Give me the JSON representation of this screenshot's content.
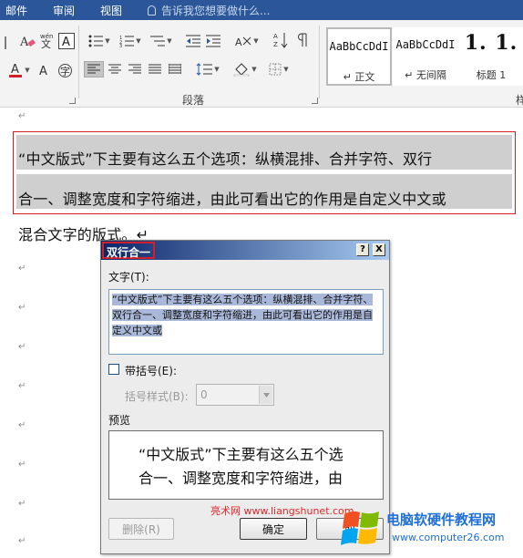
{
  "ribbon_tabs": [
    "邮件",
    "审阅",
    "视图"
  ],
  "tell_me": "告诉我您想要做什么...",
  "paragraph_group_label": "段落",
  "styles": [
    {
      "sample": "AaBbCcDdI",
      "name": "↵ 正文"
    },
    {
      "sample": "AaBbCcDdI",
      "name": "↵ 无间隔"
    },
    {
      "sample": "1. 1.",
      "name": "标题 1"
    }
  ],
  "styles_group_label_partial": "样",
  "document": {
    "paragraph_mark": "↵",
    "selected_line_1": "“中文版式”下主要有这么五个选项：纵横混排、合并字符、双行",
    "selected_line_2": "合一、调整宽度和字符缩进，由此可看出它的作用是自定义中文或",
    "line_3": "混合文字的版式。↵"
  },
  "dialog": {
    "title": "双行合一",
    "help_button": "?",
    "close_button": "X",
    "text_label": "文字(T):",
    "text_value": "“中文版式”下主要有这么五个选项：纵横混排、合并字符、双行合一、调整宽度和字符缩进，由此可看出它的作用是自定义中文或",
    "bracket_checkbox_label": "带括号(E):",
    "bracket_checked": false,
    "bracket_style_label": "括号样式(B):",
    "bracket_style_value": "0",
    "preview_label": "预览",
    "preview_line_1": "“中文版式”下主要有这么五个选",
    "preview_line_2": "合一、调整宽度和字符缩进，由",
    "delete_button": "删除(R)",
    "ok_button": "确定",
    "cancel_button": "取"
  },
  "watermarks": {
    "site_text": "亮术网 www.liangshunet.com",
    "brand_title": "电脑软硬件教程网",
    "brand_url": "www.computer26.com"
  },
  "colors": {
    "ribbon_tab_bar": "#2b579a",
    "selection_frame": "#d0202a",
    "dialog_title_start": "#0a246a",
    "dialog_title_end": "#a6caf0",
    "brand_blue": "#1e6fd6"
  },
  "icons": [
    "clear-format-icon",
    "pinyin-guide-icon",
    "character-border-icon",
    "bullets-icon",
    "numbering-icon",
    "multilevel-list-icon",
    "decrease-indent-icon",
    "increase-indent-icon",
    "chinese-layout-icon",
    "sort-icon",
    "show-marks-icon",
    "font-color-icon",
    "highlight-icon",
    "enclose-character-icon",
    "align-left-icon",
    "center-icon",
    "align-right-icon",
    "justify-icon",
    "distributed-icon",
    "line-spacing-icon",
    "shading-icon",
    "borders-icon"
  ]
}
